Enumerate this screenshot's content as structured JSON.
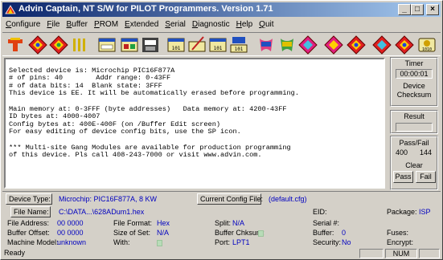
{
  "window": {
    "title": "Advin Captain, NT S/W for PILOT Programmers. Version 1.71",
    "minimize": "_",
    "maximize": "□",
    "close": "×"
  },
  "menu": [
    {
      "label": "Configure",
      "key": "C",
      "rest": "onfigure"
    },
    {
      "label": "File",
      "key": "F",
      "rest": "ile"
    },
    {
      "label": "Buffer",
      "key": "B",
      "rest": "uffer"
    },
    {
      "label": "PROM",
      "key": "P",
      "rest": "ROM"
    },
    {
      "label": "Extended",
      "key": "E",
      "rest": "xtended"
    },
    {
      "label": "Serial",
      "key": "S",
      "rest": "erial"
    },
    {
      "label": "Diagnostic",
      "key": "D",
      "rest": "iagnostic"
    },
    {
      "label": "Help",
      "key": "H",
      "rest": "elp"
    },
    {
      "label": "Quit",
      "key": "Q",
      "rest": "uit"
    }
  ],
  "toolbar": {
    "tool_icons": [
      "device-select-icon",
      "program-icon",
      "verify-icon",
      "dots-grid-icon",
      "load-file-icon",
      "save-file-icon",
      "buffer-icon",
      "chip-read-icon",
      "edit-buffer-icon",
      "checksum-icon",
      "serial-icon",
      "erase-icon",
      "blank-check-icon",
      "auto-icon",
      "security-icon",
      "config-icon",
      "nav-icon",
      "help-icon"
    ]
  },
  "message": {
    "lines": [
      "",
      "Selected device is: Microchip PIC16F877A",
      "# of pins: 40        Addr range: 0-43FF",
      "# of data bits: 14  Blank state: 3FFF",
      "This device is EE. It will be automatically erased before programming.",
      "",
      "Main memory at: 0-3FFF (byte addresses)   Data memory at: 4200-43FF",
      "ID bytes at: 4000-4007",
      "Config bytes at: 400E-400F (on /Buffer Edit screen)",
      "For easy editing of device config bits, use the SP icon.",
      "",
      "*** Multi-site Gang Modules are available for production programming",
      "of this device. Pls call 408-243-7000 or visit www.advin.com."
    ]
  },
  "right_panel": {
    "timer_label": "Timer",
    "timer_value": "00:00:01",
    "device_checksum_label_1": "Device",
    "device_checksum_label_2": "Checksum",
    "result_label": "Result",
    "passfail_label": "Pass/Fail",
    "pass_count": "400",
    "fail_count": "144",
    "clear_label": "Clear",
    "pass_button": "Pass",
    "fail_button": "Fail"
  },
  "info": {
    "device_type_label": "Device Type:",
    "device_type_value": "Microchip: PIC16F877A, 8 KW",
    "current_config_label": "Current Config File:",
    "current_config_value": "(default.cfg)",
    "file_name_label": "File Name:",
    "file_name_value": "C:\\DATA...\\628ADum1.hex",
    "eid_label": "EID:",
    "package_label": "Package:",
    "package_value": "ISP",
    "file_address_label": "File Address:",
    "file_address_value": "00 0000",
    "file_format_label": "File Format:",
    "file_format_value": "Hex",
    "split_label": "Split:",
    "split_value": "N/A",
    "serial_label": "Serial #:",
    "buffer_offset_label": "Buffer Offset:",
    "buffer_offset_value": "00 0000",
    "size_of_set_label": "Size of Set:",
    "size_of_set_value": "N/A",
    "buffer_chksum_label": "Buffer Chksum:",
    "buffer_label": "Buffer:",
    "buffer_value": "0",
    "fuses_label": "Fuses:",
    "machine_model_label": "Machine Model:",
    "machine_model_value": "unknown",
    "with_label": "With:",
    "port_label": "Port:",
    "port_value": "LPT1",
    "security_label": "Security:",
    "security_value": "No",
    "encrypt_label": "Encrypt:"
  },
  "status": {
    "text": "Ready",
    "num": "NUM"
  },
  "colors": {
    "title_start": "#0a246a",
    "title_end": "#a6caf0",
    "value_blue": "#0000c0",
    "face": "#d4d0c8"
  }
}
